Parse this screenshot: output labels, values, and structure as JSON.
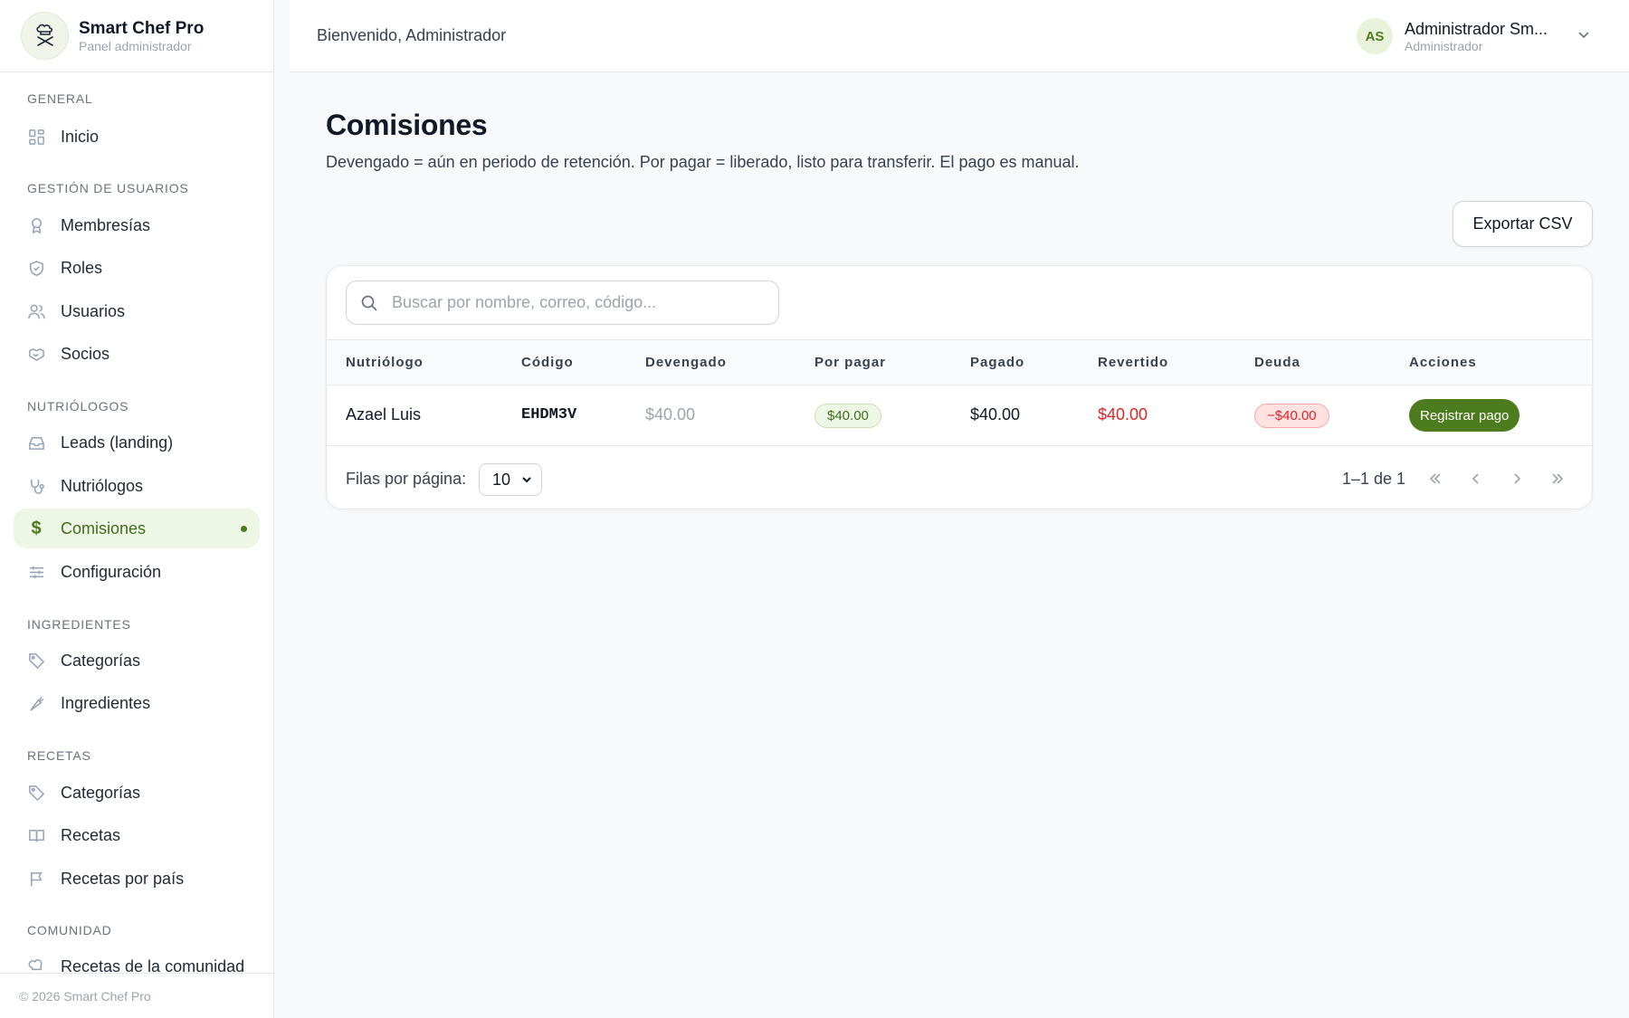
{
  "brand": {
    "name": "Smart Chef Pro",
    "subtitle": "Panel administrador"
  },
  "sidebar": {
    "sections": [
      {
        "title": "General",
        "items": [
          {
            "label": "Inicio",
            "icon": "grid-icon"
          }
        ]
      },
      {
        "title": "Gestión de usuarios",
        "items": [
          {
            "label": "Membresías",
            "icon": "badge-icon"
          },
          {
            "label": "Roles",
            "icon": "shield-icon"
          },
          {
            "label": "Usuarios",
            "icon": "users-icon"
          },
          {
            "label": "Socios",
            "icon": "handshake-icon"
          }
        ]
      },
      {
        "title": "Nutriólogos",
        "items": [
          {
            "label": "Leads (landing)",
            "icon": "inbox-icon"
          },
          {
            "label": "Nutriólogos",
            "icon": "stethoscope-icon"
          },
          {
            "label": "Comisiones",
            "icon": "dollar-icon",
            "active": true
          },
          {
            "label": "Configuración",
            "icon": "sliders-icon"
          }
        ]
      },
      {
        "title": "Ingredientes",
        "items": [
          {
            "label": "Categorías",
            "icon": "tag-icon"
          },
          {
            "label": "Ingredientes",
            "icon": "carrot-icon"
          }
        ]
      },
      {
        "title": "Recetas",
        "items": [
          {
            "label": "Categorías",
            "icon": "tag-icon"
          },
          {
            "label": "Recetas",
            "icon": "book-icon"
          },
          {
            "label": "Recetas por país",
            "icon": "flag-icon"
          }
        ]
      },
      {
        "title": "Comunidad",
        "items": [
          {
            "label": "Recetas de la comunidad",
            "icon": "chef-hat-icon"
          }
        ]
      }
    ],
    "footer": "© 2026 Smart Chef Pro"
  },
  "header": {
    "welcome": "Bienvenido, Administrador",
    "user": {
      "initials": "AS",
      "name": "Administrador Sm...",
      "role": "Administrador"
    }
  },
  "main": {
    "title": "Comisiones",
    "description": "Devengado = aún en periodo de retención. Por pagar = liberado, listo para transferir. El pago es manual.",
    "export_label": "Exportar CSV",
    "search_placeholder": "Buscar por nombre, correo, código...",
    "columns": [
      "Nutriólogo",
      "Código",
      "Devengado",
      "Por pagar",
      "Pagado",
      "Revertido",
      "Deuda",
      "Acciones"
    ],
    "rows": [
      {
        "nutriologo": "Azael Luis",
        "codigo": "EHDM3V",
        "devengado": "$40.00",
        "por_pagar": "$40.00",
        "pagado": "$40.00",
        "revertido": "$40.00",
        "deuda": "−$40.00",
        "accion": "Registrar pago"
      }
    ],
    "rows_per_page_label": "Filas por página:",
    "rows_per_page": "10",
    "range": "1–1 de 1"
  },
  "colors": {
    "accent": "#4d7c1f",
    "accent_bg": "#eef6e6",
    "danger": "#dc2626"
  }
}
